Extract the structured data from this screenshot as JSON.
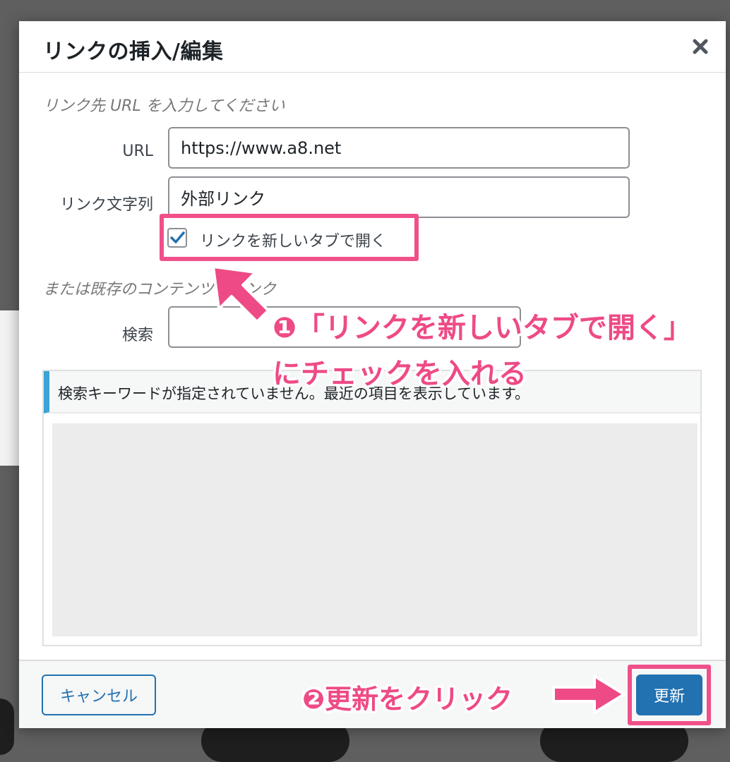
{
  "dialog": {
    "title": "リンクの挿入/編集",
    "close_icon": "close-icon",
    "section_url_label": "リンク先 URL を入力してください",
    "url_label": "URL",
    "url_value": "https://www.a8.net",
    "link_text_label": "リンク文字列",
    "link_text_value": "外部リンク",
    "new_tab_checked": true,
    "new_tab_label": "リンクを新しいタブで開く",
    "section_existing_label": "または既存のコンテンツにリンク",
    "search_label": "検索",
    "search_value": "",
    "notice_text": "検索キーワードが指定されていません。最近の項目を表示しています。",
    "cancel_label": "キャンセル",
    "update_label": "更新"
  },
  "annotations": {
    "step1_line1": "❶「リンクを新しいタブで開く」",
    "step1_line2": "にチェックを入れる",
    "step2": "❷更新をクリック"
  },
  "colors": {
    "accent": "#2271b1",
    "highlight": "#f0508a",
    "annotation_text": "#ee4a86",
    "notice_border": "#3ba3d6",
    "overlay": "#5f5f5f"
  }
}
